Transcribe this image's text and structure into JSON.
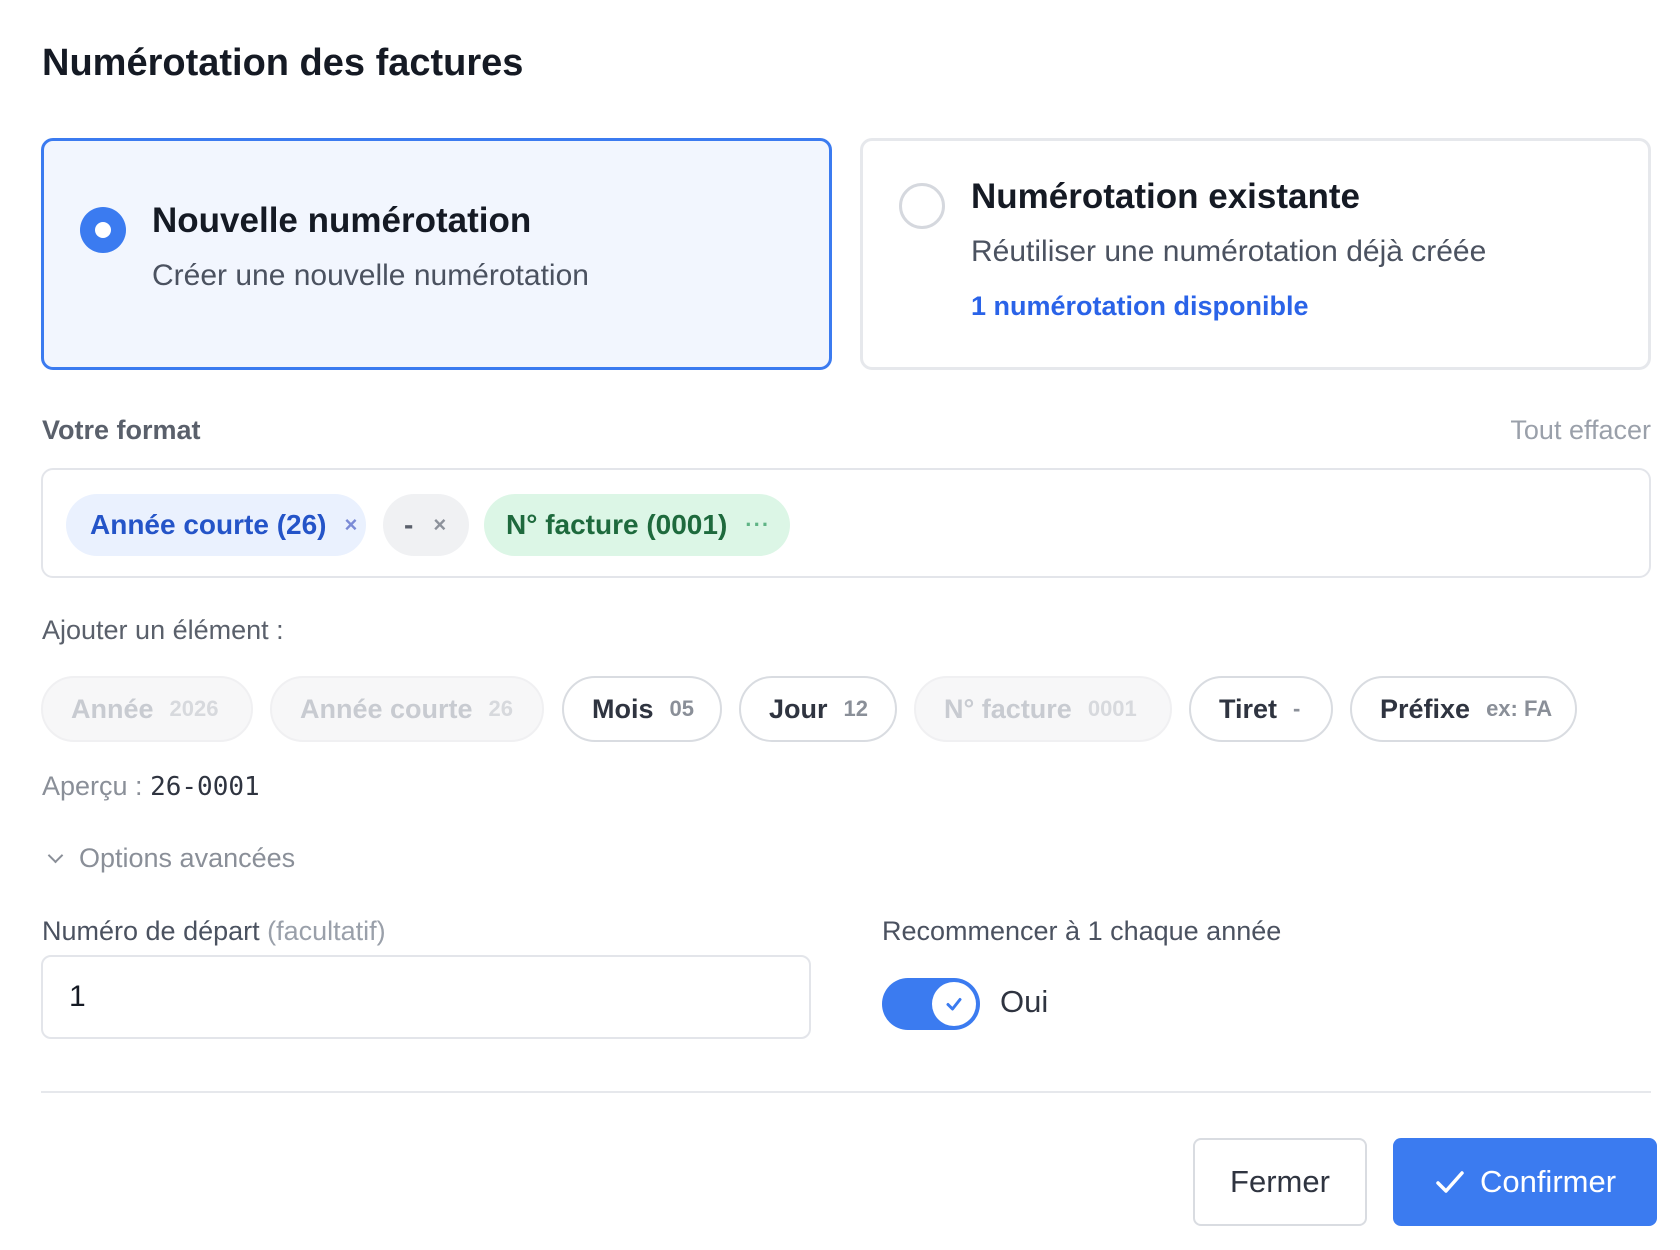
{
  "title": "Numérotation des factures",
  "options": {
    "new": {
      "title": "Nouvelle numérotation",
      "subtitle": "Créer une nouvelle numérotation",
      "selected": true
    },
    "existing": {
      "title": "Numérotation existante",
      "subtitle": "Réutiliser une numérotation déjà créée",
      "link": "1 numérotation disponible",
      "selected": false
    }
  },
  "format": {
    "label": "Votre format",
    "clear_label": "Tout effacer",
    "chips": [
      {
        "label": "Année courte (26)",
        "action": "×"
      },
      {
        "label": "-",
        "action": "×"
      },
      {
        "label": "N° facture (0001)",
        "action": "···"
      }
    ]
  },
  "add": {
    "label": "Ajouter un élément :",
    "items": [
      {
        "label": "Année",
        "sample": "2026",
        "disabled": true
      },
      {
        "label": "Année courte",
        "sample": "26",
        "disabled": true
      },
      {
        "label": "Mois",
        "sample": "05",
        "disabled": false
      },
      {
        "label": "Jour",
        "sample": "12",
        "disabled": false
      },
      {
        "label": "N° facture",
        "sample": "0001",
        "disabled": true
      },
      {
        "label": "Tiret",
        "sample": "-",
        "disabled": false
      },
      {
        "label": "Préfixe",
        "sample": "ex: FA",
        "disabled": false
      }
    ]
  },
  "preview": {
    "label": "Aperçu :",
    "value": "26-0001"
  },
  "advanced": {
    "label": "Options avancées"
  },
  "start_number": {
    "label": "Numéro de départ",
    "optional": "(facultatif)",
    "value": "1"
  },
  "reset_yearly": {
    "label": "Recommencer à 1 chaque année",
    "state_label": "Oui",
    "enabled": true
  },
  "buttons": {
    "close": "Fermer",
    "confirm": "Confirmer"
  },
  "colors": {
    "accent": "#3b7bf0",
    "link": "#2a63e8",
    "chip_blue_bg": "#eaf1fe",
    "chip_green_bg": "#dcf6e6"
  }
}
